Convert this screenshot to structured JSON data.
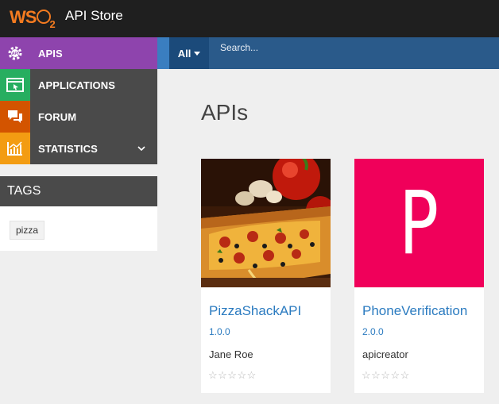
{
  "header": {
    "logo_text": "WSO",
    "logo_sub": "2",
    "title": "API Store"
  },
  "sidebar": {
    "items": [
      {
        "label": "APIS",
        "icon": "gear-api-icon",
        "color": "#8e44ad"
      },
      {
        "label": "APPLICATIONS",
        "icon": "application-window-icon",
        "color": "#27ae60"
      },
      {
        "label": "FORUM",
        "icon": "chat-bubbles-icon",
        "color": "#d35400"
      },
      {
        "label": "STATISTICS",
        "icon": "bar-chart-icon",
        "color": "#f39c12"
      }
    ]
  },
  "tags": {
    "title": "TAGS",
    "items": [
      "pizza"
    ]
  },
  "search": {
    "scope": "All",
    "placeholder": "Search..."
  },
  "main": {
    "title": "APIs",
    "apis": [
      {
        "name": "PizzaShackAPI",
        "version": "1.0.0",
        "provider": "Jane Roe",
        "rating": "☆☆☆☆☆",
        "thumbnail": "pizza-photo"
      },
      {
        "name": "PhoneVerification",
        "version": "2.0.0",
        "provider": "apicreator",
        "rating": "☆☆☆☆☆",
        "thumbnail_letter": "P",
        "thumbnail_color": "#f0005a"
      }
    ]
  }
}
